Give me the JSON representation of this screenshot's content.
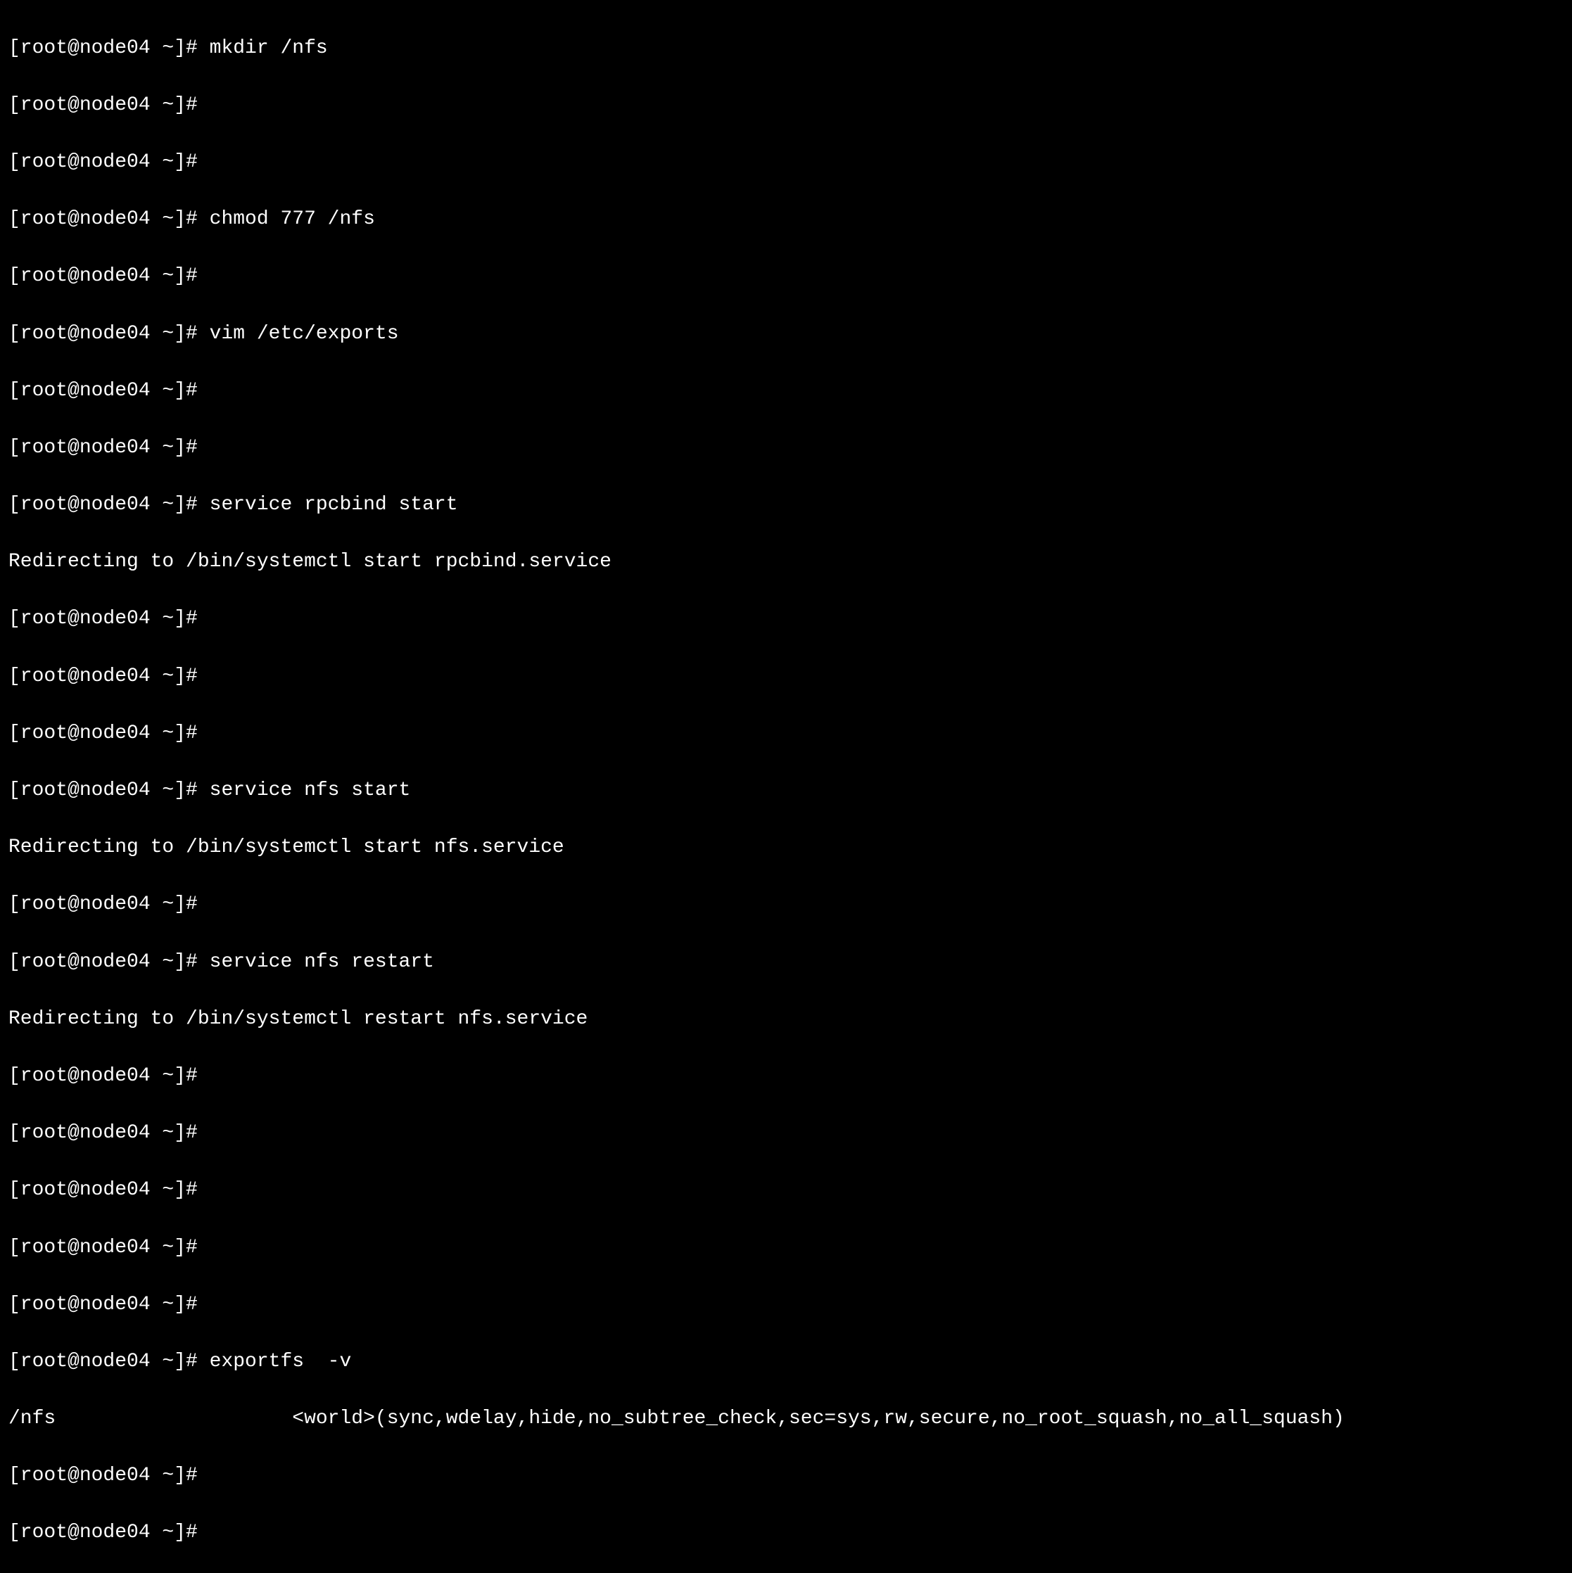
{
  "terminal": {
    "lines": [
      {
        "type": "prompt",
        "text": "[root@node04 ~]# mkdir /nfs"
      },
      {
        "type": "prompt",
        "text": "[root@node04 ~]#"
      },
      {
        "type": "prompt",
        "text": "[root@node04 ~]#"
      },
      {
        "type": "prompt",
        "text": "[root@node04 ~]# chmod 777 /nfs"
      },
      {
        "type": "prompt",
        "text": "[root@node04 ~]#"
      },
      {
        "type": "prompt",
        "text": "[root@node04 ~]# vim /etc/exports"
      },
      {
        "type": "prompt",
        "text": "[root@node04 ~]#"
      },
      {
        "type": "prompt",
        "text": "[root@node04 ~]#"
      },
      {
        "type": "prompt",
        "text": "[root@node04 ~]# service rpcbind start"
      },
      {
        "type": "output",
        "text": "Redirecting to /bin/systemctl start rpcbind.service"
      },
      {
        "type": "prompt",
        "text": "[root@node04 ~]#"
      },
      {
        "type": "prompt",
        "text": "[root@node04 ~]#"
      },
      {
        "type": "prompt",
        "text": "[root@node04 ~]#"
      },
      {
        "type": "prompt",
        "text": "[root@node04 ~]# service nfs start"
      },
      {
        "type": "output",
        "text": "Redirecting to /bin/systemctl start nfs.service"
      },
      {
        "type": "prompt",
        "text": "[root@node04 ~]#"
      },
      {
        "type": "prompt",
        "text": "[root@node04 ~]# service nfs restart"
      },
      {
        "type": "output",
        "text": "Redirecting to /bin/systemctl restart nfs.service"
      },
      {
        "type": "prompt",
        "text": "[root@node04 ~]#"
      },
      {
        "type": "prompt",
        "text": "[root@node04 ~]#"
      },
      {
        "type": "prompt",
        "text": "[root@node04 ~]#"
      },
      {
        "type": "prompt",
        "text": "[root@node04 ~]#"
      },
      {
        "type": "prompt",
        "text": "[root@node04 ~]#"
      },
      {
        "type": "prompt",
        "text": "[root@node04 ~]# exportfs  -v"
      },
      {
        "type": "output",
        "text": "/nfs                \t<world>(sync,wdelay,hide,no_subtree_check,sec=sys,rw,secure,no_root_squash,no_all_squash)"
      },
      {
        "type": "prompt",
        "text": "[root@node04 ~]#"
      },
      {
        "type": "prompt",
        "text": "[root@node04 ~]#"
      }
    ]
  }
}
